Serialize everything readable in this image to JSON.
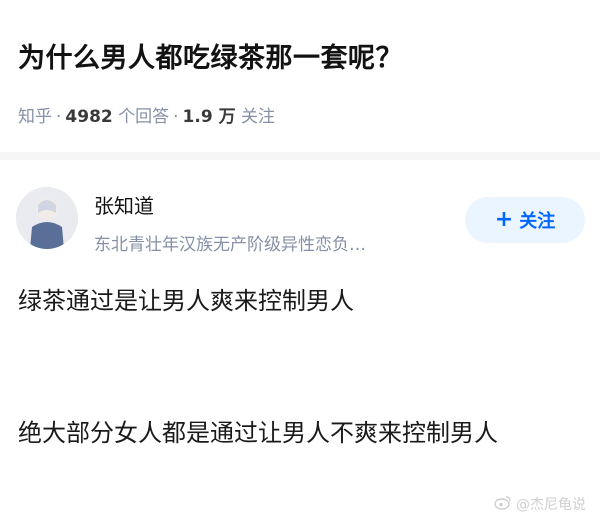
{
  "question": {
    "title": "为什么男人都吃绿茶那一套呢？",
    "source": "知乎",
    "answer_count": "4982",
    "answer_label": "个回答",
    "follower_count": "1.9 万",
    "follower_label": "关注"
  },
  "author": {
    "name": "张知道",
    "bio": "东北青壮年汉族无产阶级异性恋负…",
    "follow_label": "关注",
    "follow_icon": "+"
  },
  "answer": {
    "paragraphs": [
      "绿茶通过是让男人爽来控制男人",
      "绝大部分女人都是通过让男人不爽来控制男人"
    ]
  },
  "watermark": {
    "icon": "weibo-icon",
    "text": "@杰尼龟说"
  },
  "colors": {
    "accent": "#0066ff",
    "accent_bg": "#ebf5ff",
    "meta_gray": "#8590a6",
    "divider": "#f6f6f6"
  }
}
